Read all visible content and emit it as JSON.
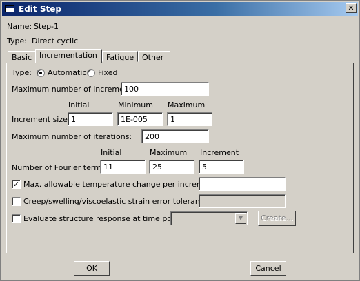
{
  "window": {
    "title": "Edit Step",
    "close_glyph": "✕"
  },
  "info": {
    "name_label": "Name:",
    "name_value": "Step-1",
    "type_label": "Type:",
    "type_value": "Direct cyclic"
  },
  "tabs": [
    {
      "label": "Basic"
    },
    {
      "label": "Incrementation"
    },
    {
      "label": "Fatigue"
    },
    {
      "label": "Other"
    }
  ],
  "incrementation": {
    "type_label": "Type:",
    "type_options": [
      "Automatic",
      "Fixed"
    ],
    "type_selected": "Automatic",
    "max_increments_label": "Maximum number of increments:",
    "max_increments_value": "100",
    "increment_size_label": "Increment size:",
    "increment_headers": [
      "Initial",
      "Minimum",
      "Maximum"
    ],
    "increment_values": [
      "1",
      "1E-005",
      "1"
    ],
    "max_iterations_label": "Maximum number of iterations:",
    "max_iterations_value": "200",
    "fourier_label": "Number of Fourier terms:",
    "fourier_headers": [
      "Initial",
      "Maximum",
      "Increment"
    ],
    "fourier_values": [
      "11",
      "25",
      "5"
    ],
    "temp_change_label": "Max. allowable temperature change per  increment:",
    "temp_change_checked": true,
    "temp_change_value": "",
    "creep_label": "Creep/swelling/viscoelastic strain error tolerance:",
    "creep_checked": false,
    "creep_value": "",
    "evaluate_label": "Evaluate structure response at time points:",
    "evaluate_checked": false,
    "evaluate_value": "",
    "create_label": "Create..."
  },
  "buttons": {
    "ok": "OK",
    "cancel": "Cancel"
  }
}
